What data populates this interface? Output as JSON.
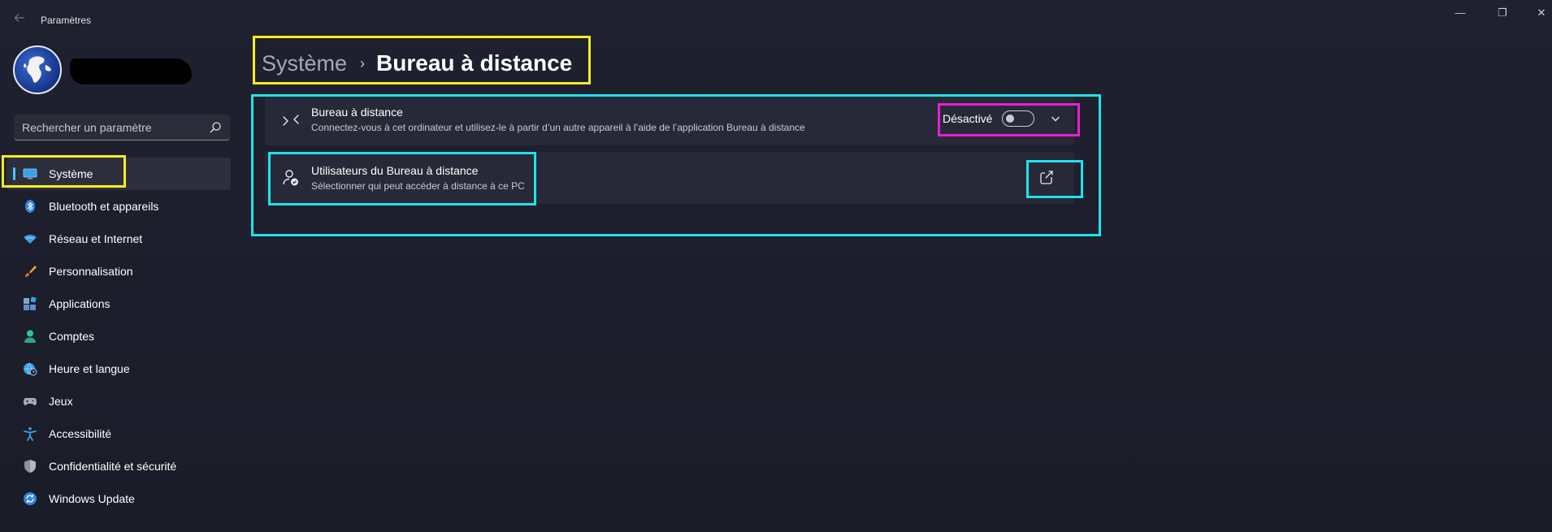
{
  "window": {
    "title": "Paramètres",
    "controls": {
      "minimize": "—",
      "maximize": "❐",
      "close": "✕"
    }
  },
  "search": {
    "placeholder": "Rechercher un paramètre"
  },
  "sidebar": {
    "items": [
      {
        "label": "Système",
        "icon": "monitor-icon",
        "active": true
      },
      {
        "label": "Bluetooth et appareils",
        "icon": "bluetooth-icon"
      },
      {
        "label": "Réseau et Internet",
        "icon": "wifi-icon"
      },
      {
        "label": "Personnalisation",
        "icon": "brush-icon"
      },
      {
        "label": "Applications",
        "icon": "apps-icon"
      },
      {
        "label": "Comptes",
        "icon": "person-icon"
      },
      {
        "label": "Heure et langue",
        "icon": "globe-clock-icon"
      },
      {
        "label": "Jeux",
        "icon": "gamepad-icon"
      },
      {
        "label": "Accessibilité",
        "icon": "accessibility-icon"
      },
      {
        "label": "Confidentialité et sécurité",
        "icon": "shield-icon"
      },
      {
        "label": "Windows Update",
        "icon": "update-icon"
      }
    ]
  },
  "header": {
    "parent": "Système",
    "separator": "›",
    "current": "Bureau à distance"
  },
  "cards": {
    "remote_desktop": {
      "title": "Bureau à distance",
      "description": "Connectez-vous à cet ordinateur et utilisez-le à partir d’un autre appareil à l’aide de l’application Bureau à distance",
      "toggle_state_label": "Désactivé",
      "toggle_on": false
    },
    "remote_users": {
      "title": "Utilisateurs du Bureau à distance",
      "description": "Sélectionner qui peut accéder à distance à ce PC"
    }
  },
  "colors": {
    "accent": "#4cc2ff",
    "highlight_yellow": "#f5ee1f",
    "highlight_cyan": "#1fe3e9",
    "highlight_magenta": "#e81fd2"
  }
}
